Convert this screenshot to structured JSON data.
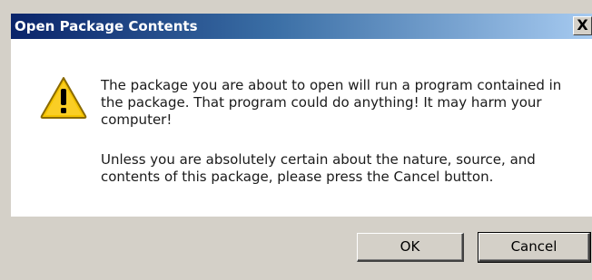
{
  "window": {
    "title": "Open Package Contents",
    "close_glyph": "X"
  },
  "icon": {
    "name": "warning-icon"
  },
  "message": {
    "paragraph1": "The package you are about to open will run a program contained in the package. That program could do anything!  It may harm your computer!",
    "paragraph2": "Unless you are absolutely certain about the nature, source, and contents of this package, please press the Cancel button."
  },
  "buttons": {
    "ok_label": "OK",
    "cancel_label": "Cancel"
  },
  "colors": {
    "titlebar_start": "#0a246a",
    "titlebar_end": "#a6caf0",
    "face": "#d4d0c8",
    "warning_yellow": "#f5c400"
  }
}
